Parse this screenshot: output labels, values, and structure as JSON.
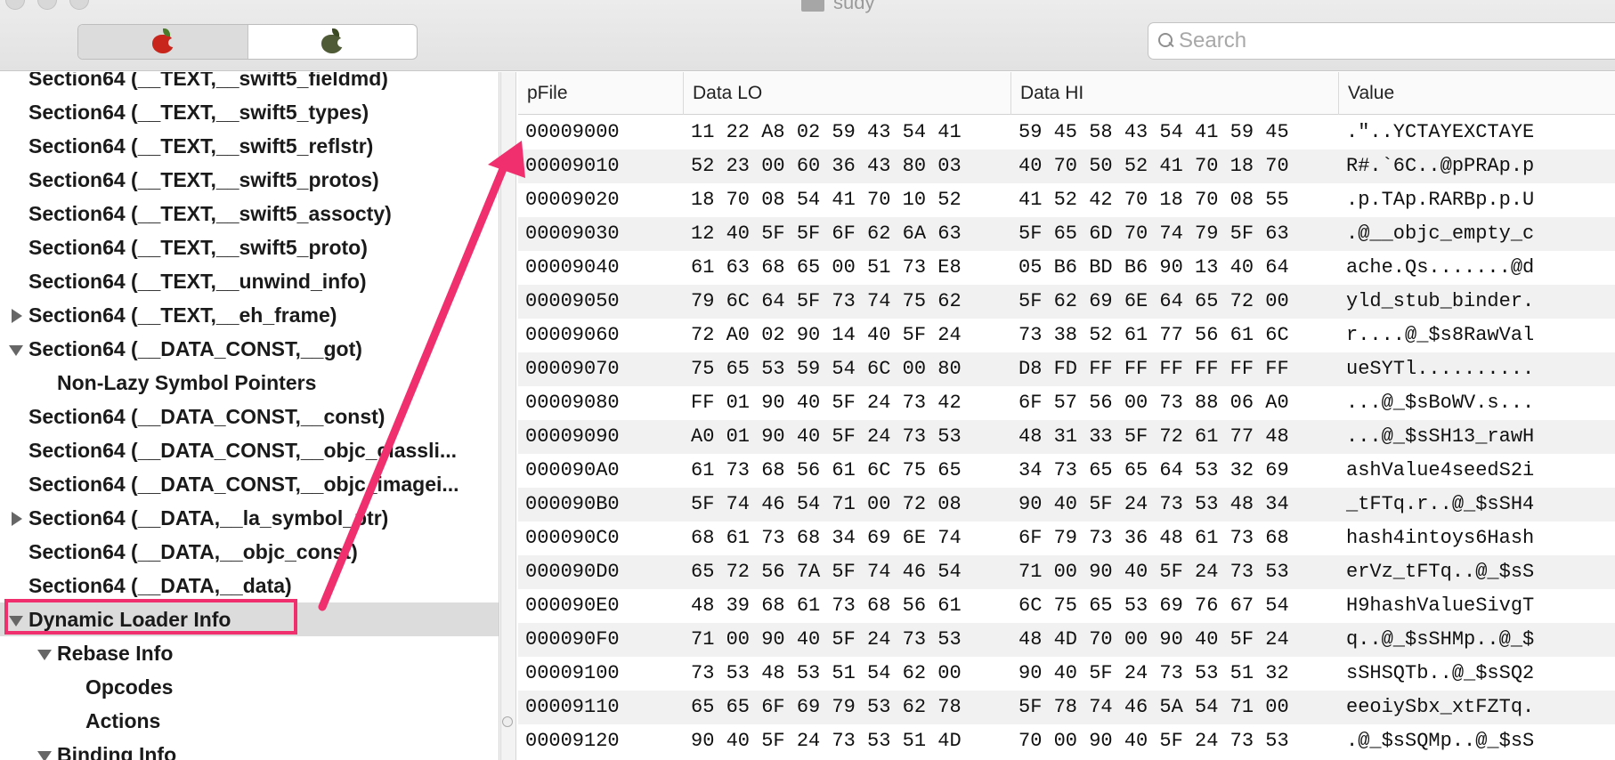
{
  "window": {
    "title": "sudy"
  },
  "toolbar": {
    "segments": [
      {
        "icon": "red-apple-icon",
        "color": "#c8261c",
        "active": true
      },
      {
        "icon": "dark-apple-icon",
        "color": "#4f5a36",
        "active": false
      }
    ]
  },
  "search": {
    "placeholder": "Search",
    "value": ""
  },
  "tree": {
    "rows": [
      {
        "label": "Section64 (__TEXT,__swift5_fieldmd)",
        "level": 0,
        "disclosure": "none"
      },
      {
        "label": "Section64 (__TEXT,__swift5_types)",
        "level": 0,
        "disclosure": "none"
      },
      {
        "label": "Section64 (__TEXT,__swift5_reflstr)",
        "level": 0,
        "disclosure": "none"
      },
      {
        "label": "Section64 (__TEXT,__swift5_protos)",
        "level": 0,
        "disclosure": "none"
      },
      {
        "label": "Section64 (__TEXT,__swift5_assocty)",
        "level": 0,
        "disclosure": "none"
      },
      {
        "label": "Section64 (__TEXT,__swift5_proto)",
        "level": 0,
        "disclosure": "none"
      },
      {
        "label": "Section64 (__TEXT,__unwind_info)",
        "level": 0,
        "disclosure": "none"
      },
      {
        "label": "Section64 (__TEXT,__eh_frame)",
        "level": 0,
        "disclosure": "closed"
      },
      {
        "label": "Section64 (__DATA_CONST,__got)",
        "level": 0,
        "disclosure": "open"
      },
      {
        "label": "Non-Lazy Symbol Pointers",
        "level": 1,
        "disclosure": "none"
      },
      {
        "label": "Section64 (__DATA_CONST,__const)",
        "level": 0,
        "disclosure": "none"
      },
      {
        "label": "Section64 (__DATA_CONST,__objc_classli...",
        "level": 0,
        "disclosure": "none"
      },
      {
        "label": "Section64 (__DATA_CONST,__objc_imagei...",
        "level": 0,
        "disclosure": "none"
      },
      {
        "label": "Section64 (__DATA,__la_symbol_ptr)",
        "level": 0,
        "disclosure": "closed"
      },
      {
        "label": "Section64 (__DATA,__objc_const)",
        "level": 0,
        "disclosure": "none"
      },
      {
        "label": "Section64 (__DATA,__data)",
        "level": 0,
        "disclosure": "none"
      },
      {
        "label": "Dynamic Loader Info",
        "level": 0,
        "disclosure": "open",
        "selected": true
      },
      {
        "label": "Rebase Info",
        "level": 1,
        "disclosure": "open"
      },
      {
        "label": "Opcodes",
        "level": 2,
        "disclosure": "none"
      },
      {
        "label": "Actions",
        "level": 2,
        "disclosure": "none"
      },
      {
        "label": "Binding Info",
        "level": 1,
        "disclosure": "open"
      }
    ]
  },
  "table": {
    "columns": [
      "pFile",
      "Data LO",
      "Data HI",
      "Value"
    ],
    "rows": [
      [
        "00009000",
        "11 22 A8 02 59 43 54 41",
        "59 45 58 43 54 41 59 45",
        ".\"..YCTAYEXCTAYE"
      ],
      [
        "00009010",
        "52 23 00 60 36 43 80 03",
        "40 70 50 52 41 70 18 70",
        "R#.`6C..@pPRAp.p"
      ],
      [
        "00009020",
        "18 70 08 54 41 70 10 52",
        "41 52 42 70 18 70 08 55",
        ".p.TAp.RARBp.p.U"
      ],
      [
        "00009030",
        "12 40 5F 5F 6F 62 6A 63",
        "5F 65 6D 70 74 79 5F 63",
        ".@__objc_empty_c"
      ],
      [
        "00009040",
        "61 63 68 65 00 51 73 E8",
        "05 B6 BD B6 90 13 40 64",
        "ache.Qs.......@d"
      ],
      [
        "00009050",
        "79 6C 64 5F 73 74 75 62",
        "5F 62 69 6E 64 65 72 00",
        "yld_stub_binder."
      ],
      [
        "00009060",
        "72 A0 02 90 14 40 5F 24",
        "73 38 52 61 77 56 61 6C",
        "r....@_$s8RawVal"
      ],
      [
        "00009070",
        "75 65 53 59 54 6C 00 80",
        "D8 FD FF FF FF FF FF FF",
        "ueSYTl.........."
      ],
      [
        "00009080",
        "FF 01 90 40 5F 24 73 42",
        "6F 57 56 00 73 88 06 A0",
        "...@_$sBoWV.s..."
      ],
      [
        "00009090",
        "A0 01 90 40 5F 24 73 53",
        "48 31 33 5F 72 61 77 48",
        "...@_$sSH13_rawH"
      ],
      [
        "000090A0",
        "61 73 68 56 61 6C 75 65",
        "34 73 65 65 64 53 32 69",
        "ashValue4seedS2i"
      ],
      [
        "000090B0",
        "5F 74 46 54 71 00 72 08",
        "90 40 5F 24 73 53 48 34",
        "_tFTq.r..@_$sSH4"
      ],
      [
        "000090C0",
        "68 61 73 68 34 69 6E 74",
        "6F 79 73 36 48 61 73 68",
        "hash4intoys6Hash"
      ],
      [
        "000090D0",
        "65 72 56 7A 5F 74 46 54",
        "71 00 90 40 5F 24 73 53",
        "erVz_tFTq..@_$sS"
      ],
      [
        "000090E0",
        "48 39 68 61 73 68 56 61",
        "6C 75 65 53 69 76 67 54",
        "H9hashValueSivgT"
      ],
      [
        "000090F0",
        "71 00 90 40 5F 24 73 53",
        "48 4D 70 00 90 40 5F 24",
        "q..@_$sSHMp..@_$"
      ],
      [
        "00009100",
        "73 53 48 53 51 54 62 00",
        "90 40 5F 24 73 53 51 32",
        "sSHSQTb..@_$sSQ2"
      ],
      [
        "00009110",
        "65 65 6F 69 79 53 62 78",
        "5F 78 74 46 5A 54 71 00",
        "eeoiySbx_xtFZTq."
      ],
      [
        "00009120",
        "90 40 5F 24 73 53 51 4D",
        "70 00 90 40 5F 24 73 53",
        ".@_$sSQMp..@_$sS"
      ]
    ]
  },
  "annotation": {
    "color": "#f0306e"
  }
}
